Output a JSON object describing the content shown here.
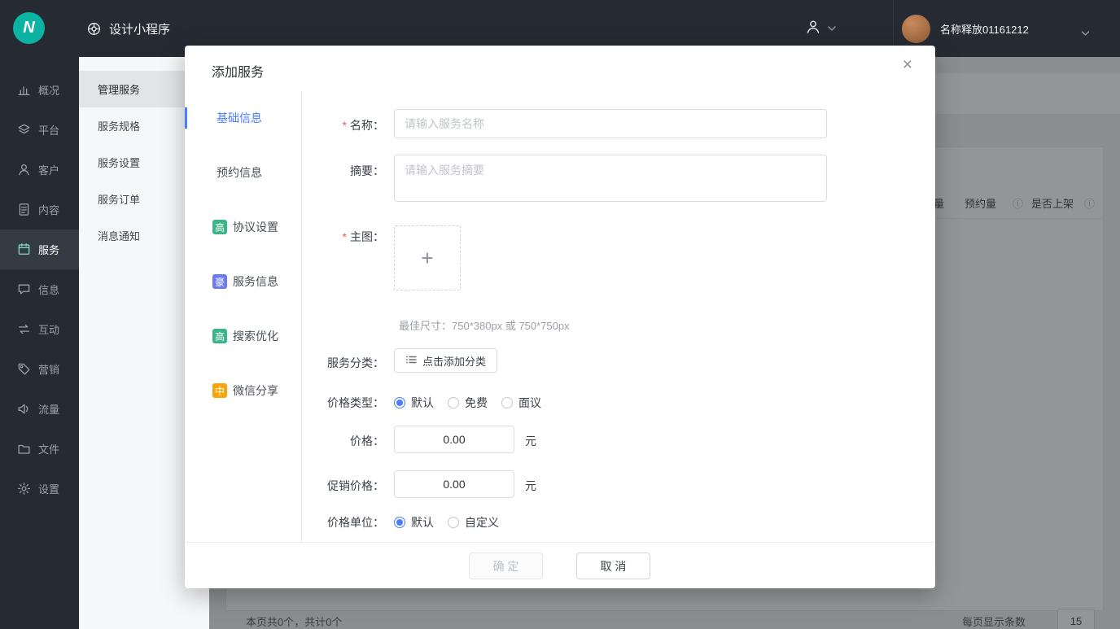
{
  "colors": {
    "accent_blue": "#4a7dff",
    "logo_teal": "#0cb2a2",
    "badge_green": "#3cb487",
    "badge_indigo": "#6a7bf2",
    "badge_orange": "#f8a40a",
    "topbar_dark": "#262b33"
  },
  "topbar": {
    "logo_letter": "N",
    "app_title": "设计小程序",
    "user_name": "名称释放01161212"
  },
  "sidebar": {
    "items": [
      {
        "label": "概况"
      },
      {
        "label": "平台"
      },
      {
        "label": "客户"
      },
      {
        "label": "内容"
      },
      {
        "label": "服务"
      },
      {
        "label": "信息"
      },
      {
        "label": "互动"
      },
      {
        "label": "营销"
      },
      {
        "label": "流量"
      },
      {
        "label": "文件"
      },
      {
        "label": "设置"
      }
    ]
  },
  "submenu": {
    "items": [
      {
        "label": "管理服务"
      },
      {
        "label": "服务规格"
      },
      {
        "label": "服务设置"
      },
      {
        "label": "服务订单"
      },
      {
        "label": "消息通知"
      }
    ]
  },
  "background": {
    "partial_column": "量",
    "column_booking": "预约量",
    "column_on_shelf": "是否上架",
    "info_icon": "ⓘ",
    "footer_summary": "本页共0个，共计0个",
    "page_size_label": "每页显示条数",
    "page_size_value": "15"
  },
  "modal": {
    "title": "添加服务",
    "close": "×",
    "tabs": [
      {
        "label": "基础信息",
        "badge": "",
        "badge_color": ""
      },
      {
        "label": "预约信息",
        "badge": "",
        "badge_color": ""
      },
      {
        "label": "协议设置",
        "badge": "高",
        "badge_color": "#3cb487"
      },
      {
        "label": "服务信息",
        "badge": "豪",
        "badge_color": "#6a7bf2"
      },
      {
        "label": "搜索优化",
        "badge": "高",
        "badge_color": "#3cb487"
      },
      {
        "label": "微信分享",
        "badge": "中",
        "badge_color": "#f8a40a"
      }
    ],
    "form": {
      "name_label": "名称：",
      "name_placeholder": "请输入服务名称",
      "summary_label": "摘要：",
      "summary_placeholder": "请输入服务摘要",
      "image_label": "主图：",
      "upload_plus": "+",
      "image_hint": "最佳尺寸：750*380px 或 750*750px",
      "category_label": "服务分类：",
      "category_button": "点击添加分类",
      "price_type_label": "价格类型：",
      "price_type_options": [
        "默认",
        "免费",
        "面议"
      ],
      "price_type_selected": "默认",
      "price_label": "价格：",
      "price_value": "0.00",
      "price_unit": "元",
      "promo_label": "促销价格：",
      "promo_value": "0.00",
      "promo_unit": "元",
      "unit_label": "价格单位：",
      "unit_options": [
        "默认",
        "自定义"
      ],
      "unit_selected": "默认"
    },
    "footer": {
      "confirm": "确 定",
      "cancel": "取 消"
    }
  }
}
